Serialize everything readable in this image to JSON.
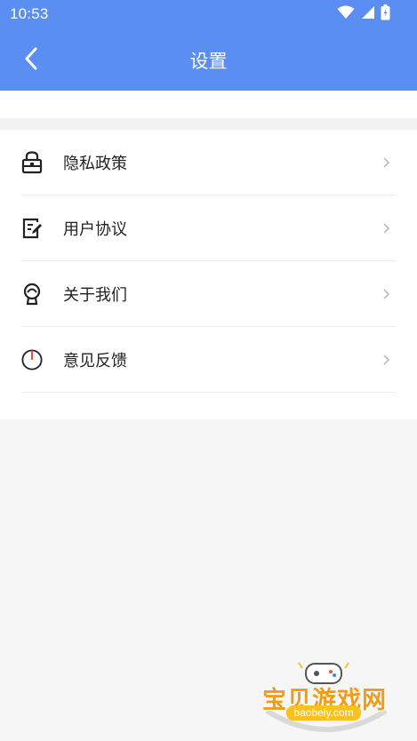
{
  "status_bar": {
    "time": "10:53",
    "icons": [
      "wifi-icon",
      "signal-icon",
      "battery-icon"
    ]
  },
  "header": {
    "title": "设置",
    "back_icon": "chevron-left-icon"
  },
  "menu": {
    "items": [
      {
        "label": "隐私政策",
        "icon": "lock-icon"
      },
      {
        "label": "用户协议",
        "icon": "agreement-icon"
      },
      {
        "label": "关于我们",
        "icon": "about-icon"
      },
      {
        "label": "意见反馈",
        "icon": "power-icon"
      }
    ],
    "arrow_icon": "chevron-right-icon"
  },
  "watermark": {
    "text": "宝贝游戏网",
    "url": "baobeiy.com"
  },
  "colors": {
    "header": "#5b8ef2",
    "background": "#f6f6f6",
    "card": "#ffffff",
    "watermark": "#f29a19"
  }
}
